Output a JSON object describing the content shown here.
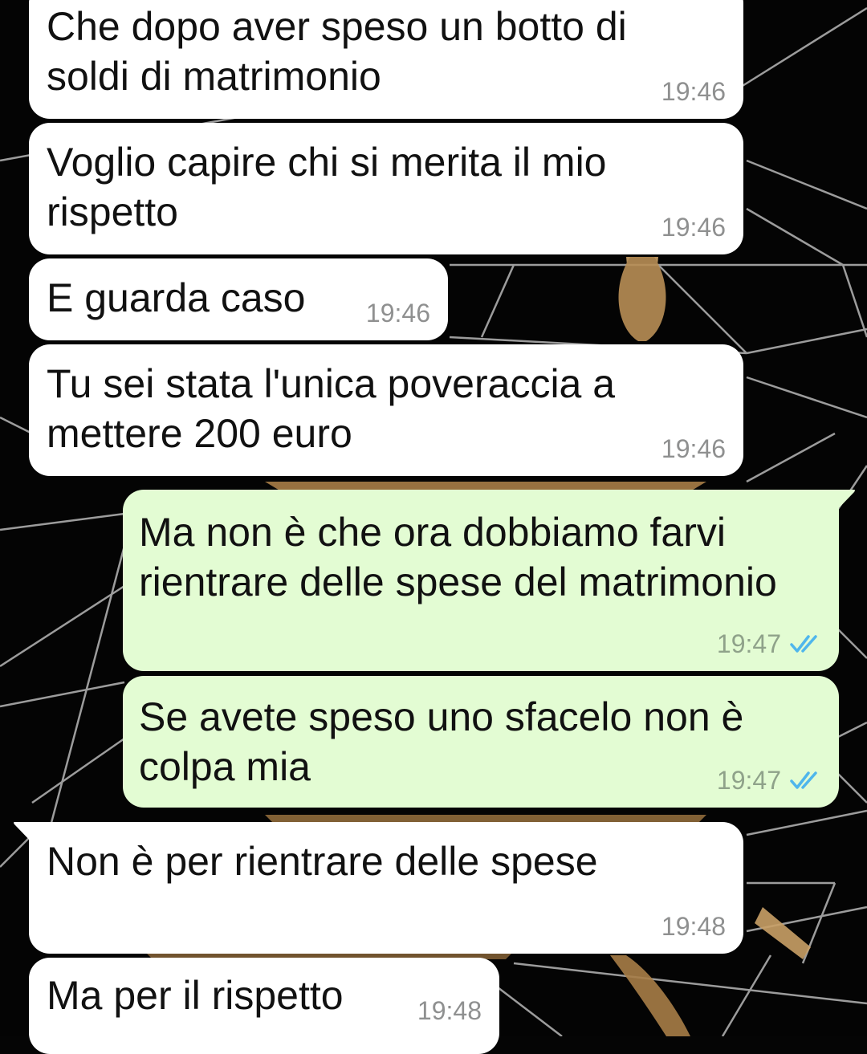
{
  "colors": {
    "incoming_bubble": "#ffffff",
    "outgoing_bubble": "#e3fcd3",
    "timestamp": "#8f9090",
    "read_ticks": "#4fb6ec"
  },
  "messages": [
    {
      "direction": "incoming",
      "lines": [
        "Che dopo aver speso un botto di",
        "soldi di matrimonio"
      ],
      "time": "19:46"
    },
    {
      "direction": "incoming",
      "lines": [
        "Voglio capire chi si merita il mio",
        "rispetto"
      ],
      "time": "19:46"
    },
    {
      "direction": "incoming",
      "lines": [
        "E guarda caso"
      ],
      "time": "19:46"
    },
    {
      "direction": "incoming",
      "lines": [
        "Tu sei stata l'unica poveraccia a",
        "mettere 200 euro"
      ],
      "time": "19:46"
    },
    {
      "direction": "outgoing",
      "lines": [
        "Ma non è che ora dobbiamo farvi",
        "rientrare delle spese del matrimonio"
      ],
      "time": "19:47",
      "status_icon": "double-check-read-icon"
    },
    {
      "direction": "outgoing",
      "lines": [
        "Se avete speso uno sfacelo non è",
        "colpa mia"
      ],
      "time": "19:47",
      "status_icon": "double-check-read-icon"
    },
    {
      "direction": "incoming",
      "lines": [
        "Non è per rientrare delle spese"
      ],
      "time": "19:48"
    },
    {
      "direction": "incoming",
      "lines": [
        "Ma per il rispetto"
      ],
      "time": "19:48"
    }
  ]
}
